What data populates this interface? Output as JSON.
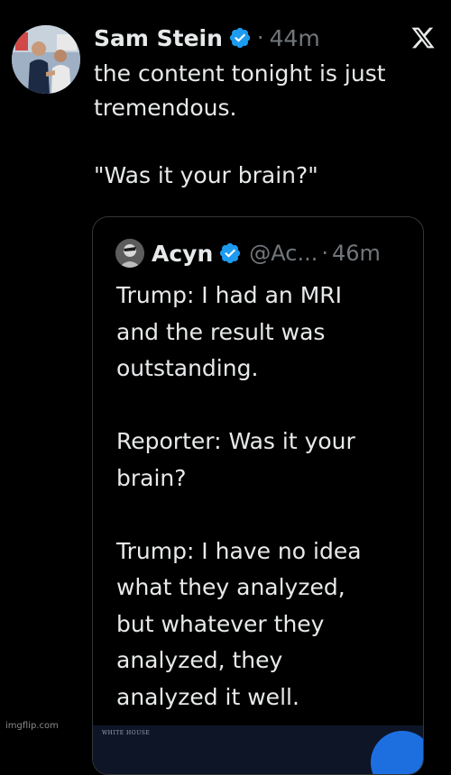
{
  "tweet": {
    "author_name": "Sam Stein",
    "timestamp": "44m",
    "separator": "·",
    "text": "the content tonight is just\ntremendous.\n\n\"Was it your brain?\""
  },
  "quoted_tweet": {
    "author_name": "Acyn",
    "handle": "@Ac...",
    "separator": "·",
    "timestamp": "46m",
    "text": "Trump: I had an MRI\nand the result was\noutstanding.\n\nReporter: Was it your\nbrain?\n\nTrump: I have no idea\nwhat they analyzed,\nbut whatever they\nanalyzed, they\nanalyzed it well."
  },
  "media": {
    "caption": "WHITE HOUSE"
  },
  "watermark": {
    "text": "imgflip.com"
  },
  "colors": {
    "background": "#000000",
    "text_primary": "#e7e9ea",
    "text_secondary": "#71767b",
    "verified_blue": "#1d9bf0",
    "card_border": "#333639"
  },
  "icons": {
    "verified": "verified-badge-icon",
    "app_logo": "x-logo-icon"
  }
}
